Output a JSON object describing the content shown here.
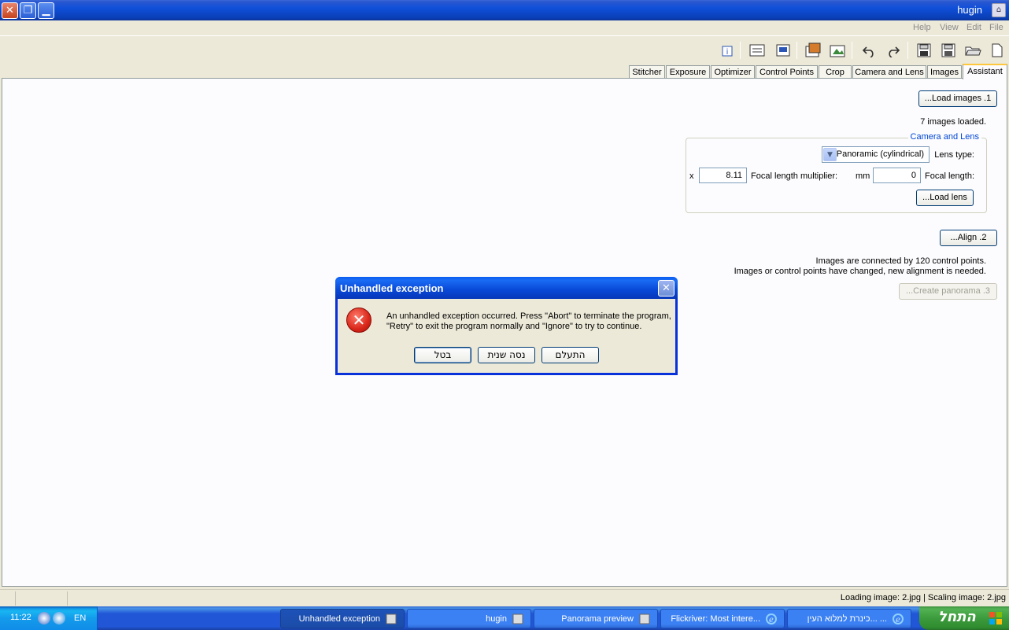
{
  "window": {
    "title": "hugin"
  },
  "menu": {
    "items": [
      "Help",
      "View",
      "Edit",
      "File"
    ]
  },
  "toolbar": {
    "icons": [
      "info-icon",
      "options-icon",
      "preview-icon",
      "open-preview-icon",
      "gl-preview-icon",
      "undo-icon",
      "redo-icon",
      "save-as-icon",
      "save-icon",
      "open-icon",
      "new-icon"
    ]
  },
  "tabs": {
    "items": [
      "Stitcher",
      "Exposure",
      "Optimizer",
      "Control Points",
      "Crop",
      "Camera and Lens",
      "Images",
      "Assistant"
    ],
    "active": "Assistant"
  },
  "assistant": {
    "load_images_button": "1. Load images...",
    "images_loaded_text": "7 images loaded.",
    "camera_lens_group": "Camera and Lens",
    "lens_type_label": "Lens type:",
    "lens_type_value": "Panoramic (cylindrical)",
    "focal_length_label": "Focal length:",
    "focal_length_value": "0",
    "focal_length_unit": "mm",
    "focal_multiplier_label": "Focal length multiplier:",
    "focal_multiplier_value": "8.11",
    "focal_multiplier_unit": "x",
    "load_lens_button": "Load lens...",
    "align_button": "2. Align...",
    "status_line1": "Images are connected by 120 control points.",
    "status_line2": "Images or control points have changed, new alignment is needed.",
    "create_panorama_button": "3. Create panorama..."
  },
  "dialog": {
    "title": "Unhandled exception",
    "message_line1": "An unhandled exception occurred. Press \"Abort\" to terminate the program,",
    "message_line2": "\"Retry\" to exit the program normally and \"Ignore\" to try to continue.",
    "buttons": [
      "בטל",
      "נסה שנית",
      "התעלם"
    ]
  },
  "statusbar": {
    "text": "Loading image: 2.jpg  | Scaling image: 2.jpg"
  },
  "taskbar": {
    "clock": "11:22",
    "language": "EN",
    "tasks": [
      {
        "label": "Unhandled exception",
        "active": true
      },
      {
        "label": "hugin",
        "active": false
      },
      {
        "label": "Panorama preview",
        "active": false
      },
      {
        "label": "Flickriver: Most intere...",
        "active": false
      },
      {
        "label": "כינרת למלוא העין... ...",
        "active": false
      }
    ],
    "start_label": "התחל"
  }
}
